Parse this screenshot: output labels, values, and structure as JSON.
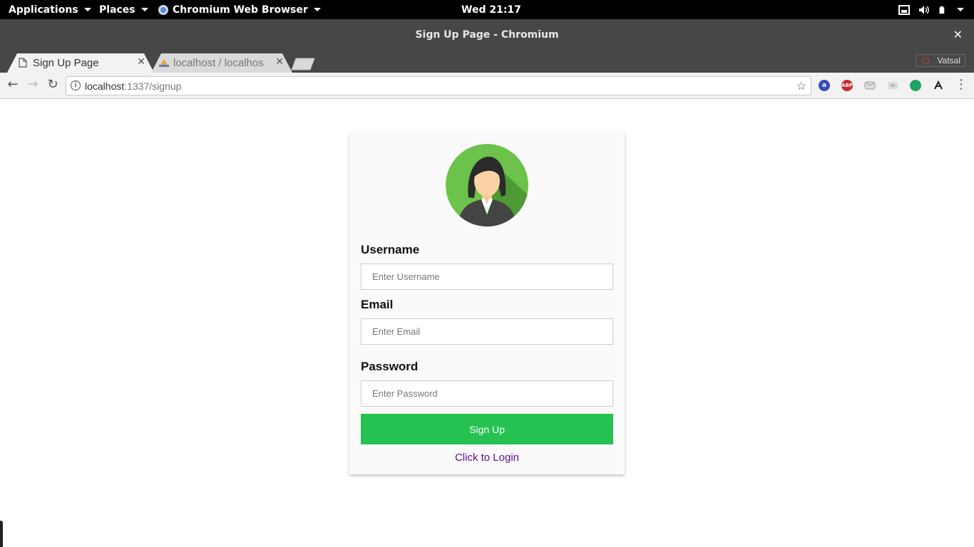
{
  "topbar": {
    "applications": "Applications",
    "places": "Places",
    "app_name": "Chromium Web Browser",
    "clock": "Wed 21:17"
  },
  "window": {
    "title": "Sign Up Page - Chromium",
    "close_glyph": "✕"
  },
  "tabs": [
    {
      "label": "Sign Up Page",
      "active": true,
      "icon": "page-icon",
      "close_glyph": "✕"
    },
    {
      "label": "localhost / localhos",
      "active": false,
      "icon": "phpmyadmin-icon",
      "close_glyph": "✕"
    }
  ],
  "profile": {
    "name": "Vatsal"
  },
  "toolbar": {
    "back_glyph": "←",
    "forward_glyph": "→",
    "reload_glyph": "↻",
    "url_host": "localhost",
    "url_path": ":1337/signup",
    "star_glyph": "☆",
    "menu_glyph": "⋮",
    "extensions": [
      "a",
      "ABP",
      "",
      "",
      "",
      ""
    ]
  },
  "form": {
    "username_label": "Username",
    "username_placeholder": "Enter Username",
    "email_label": "Email",
    "email_placeholder": "Enter Email",
    "password_label": "Password",
    "password_placeholder": "Enter Password",
    "submit_label": "Sign Up",
    "login_link": "Click to Login"
  },
  "colors": {
    "accent_green": "#25c151",
    "link_purple": "#5b0d91",
    "avatar_green": "#6cc24a"
  }
}
